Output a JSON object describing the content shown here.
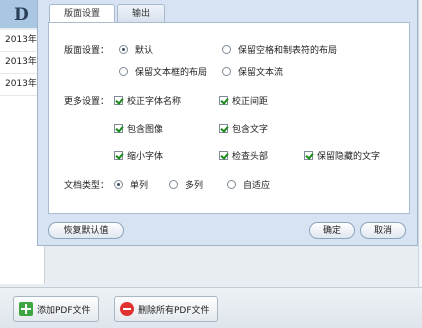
{
  "background": {
    "logo_letter": "D",
    "rows": [
      "2013年",
      "2013年",
      "2013年"
    ]
  },
  "dialog": {
    "tabs": [
      {
        "label": "版面设置",
        "active": true
      },
      {
        "label": "输出",
        "active": false
      }
    ],
    "layout_settings": {
      "label": "版面设置：",
      "options": [
        {
          "label": "默认",
          "selected": true
        },
        {
          "label": "保留空格和制表符的布局",
          "selected": false
        },
        {
          "label": "保留文本框的布局",
          "selected": false
        },
        {
          "label": "保留文本流",
          "selected": false
        }
      ]
    },
    "more_settings": {
      "label": "更多设置：",
      "checkboxes": [
        {
          "label": "校正字体名称",
          "checked": true
        },
        {
          "label": "校正间距",
          "checked": true
        },
        {
          "label": "包含图像",
          "checked": true
        },
        {
          "label": "包含文字",
          "checked": true
        },
        {
          "label": "缩小字体",
          "checked": true
        },
        {
          "label": "检查头部",
          "checked": true
        },
        {
          "label": "保留隐藏的文字",
          "checked": true
        }
      ]
    },
    "doc_type": {
      "label": "文档类型：",
      "options": [
        {
          "label": "单列",
          "selected": true
        },
        {
          "label": "多列",
          "selected": false
        },
        {
          "label": "自适应",
          "selected": false
        }
      ]
    },
    "buttons": {
      "restore_default": "恢复默认值",
      "ok": "确定",
      "cancel": "取消"
    }
  },
  "bottom_bar": {
    "add_pdf": "添加PDF文件",
    "delete_all_pdf": "删除所有PDF文件"
  }
}
